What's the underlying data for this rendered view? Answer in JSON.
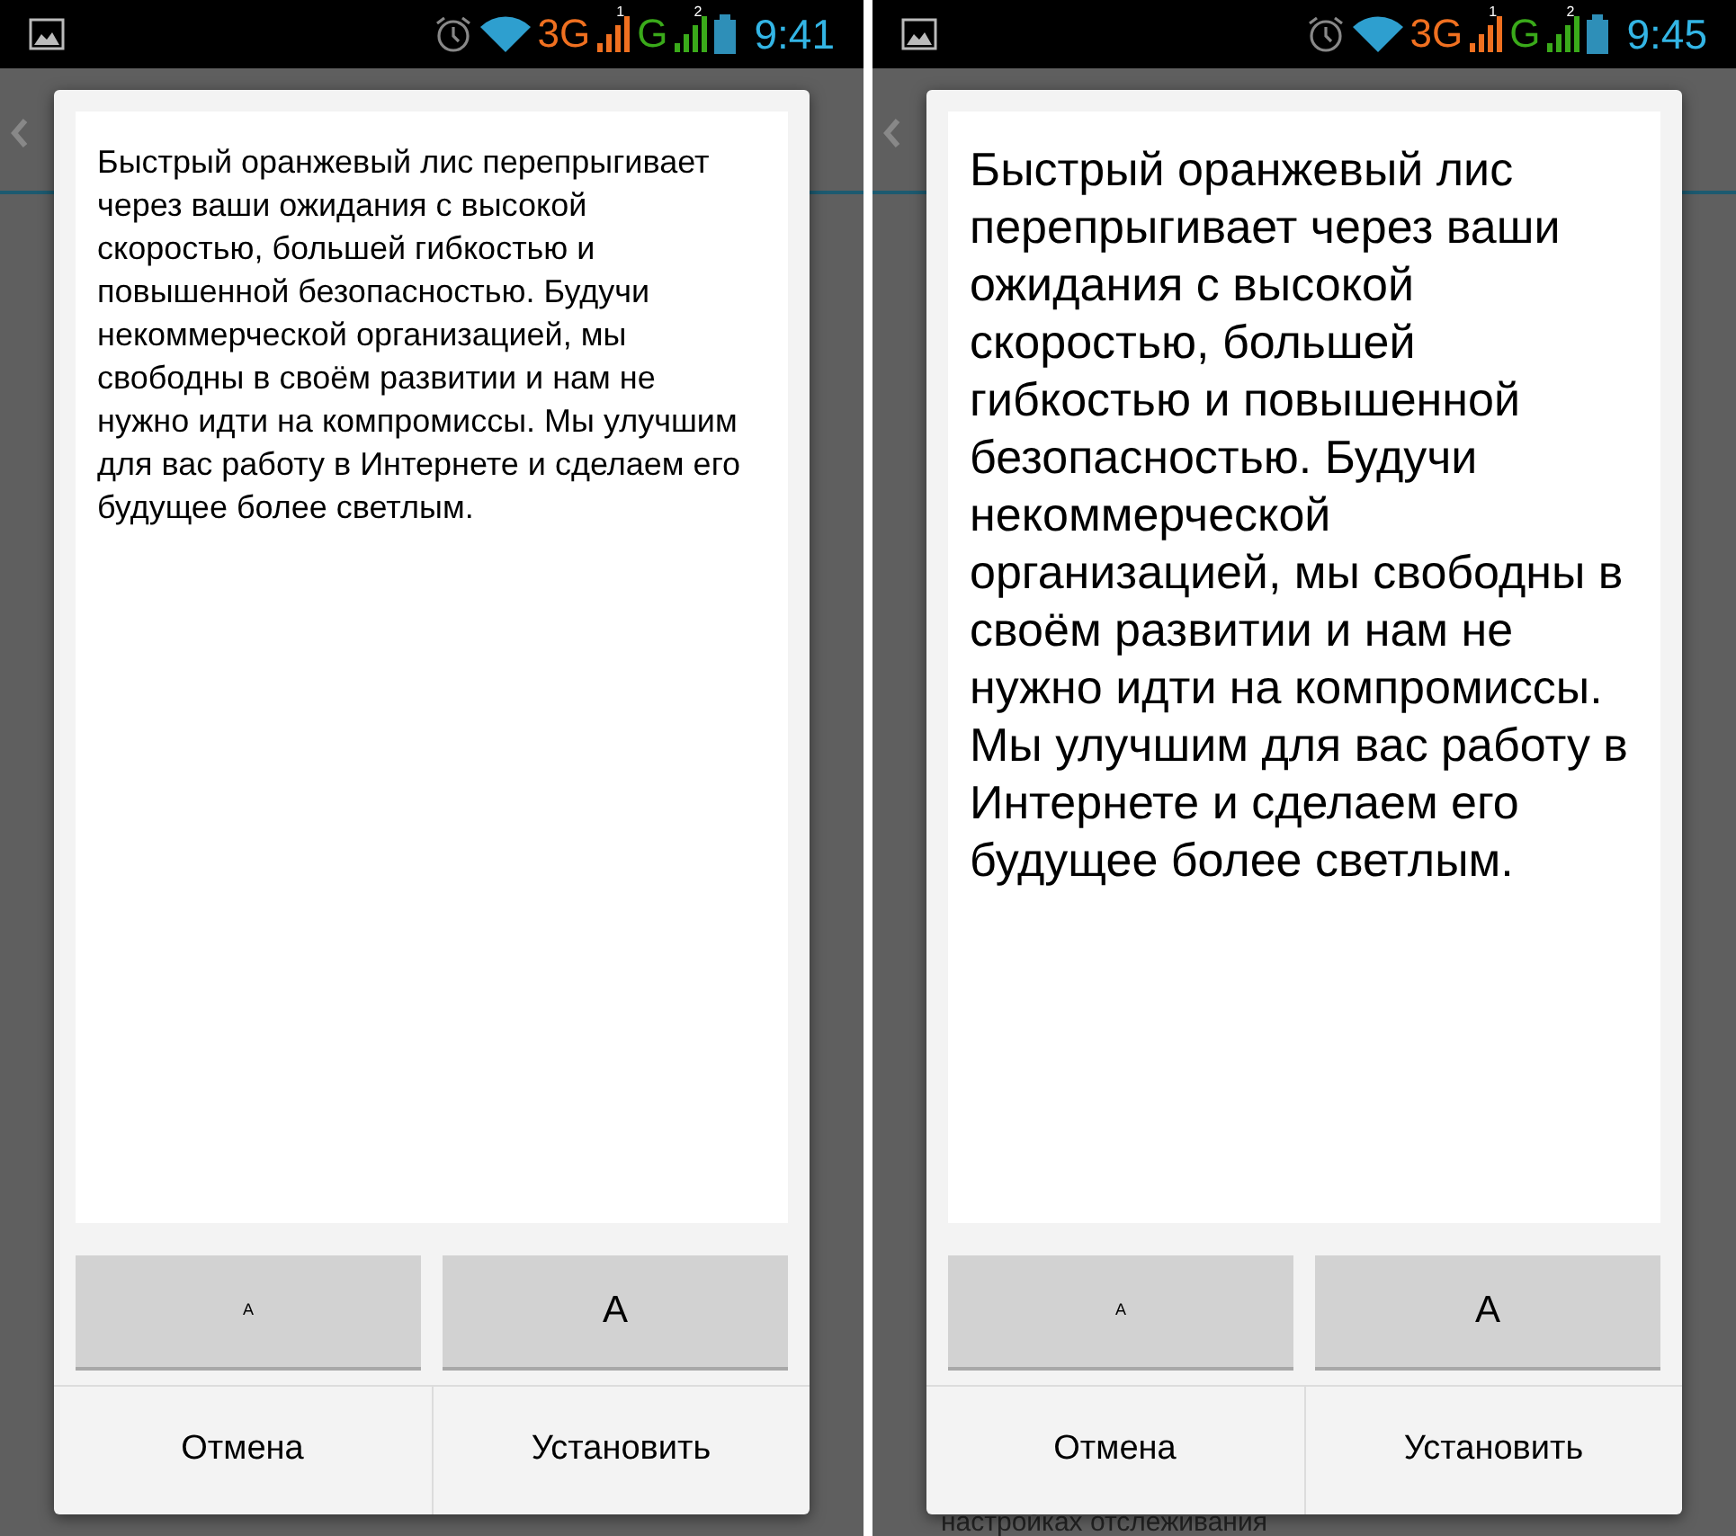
{
  "screens": [
    {
      "status_bar": {
        "network_1": "3G",
        "sim_1": "1",
        "network_2": "G",
        "sim_2": "2",
        "time": "9:41"
      },
      "dialog": {
        "kind": "normal",
        "preview_text": "Быстрый оранжевый лис перепрыгивает через ваши ожидания с высокой скоростью, большей гибкостью и повышенной безопасностью. Будучи некоммерческой организацией, мы свободны в своём развитии и нам не нужно идти на компромиссы. Мы улучшим для вас работу в Интернете и сделаем его будущее более светлым.",
        "smaller_button": "A",
        "larger_button": "A",
        "buttons": [
          "Отмена",
          "Установить"
        ]
      }
    },
    {
      "status_bar": {
        "network_1": "3G",
        "sim_1": "1",
        "network_2": "G",
        "sim_2": "2",
        "time": "9:45"
      },
      "dialog": {
        "kind": "enlarged",
        "preview_text": "Быстрый оранжевый лис перепрыгивает через ваши ожидания с высокой скоростью, большей гибкостью и повышенной безопасностью. Будучи некоммерческой организацией, мы свободны в своём развитии и нам не нужно идти на компромиссы. Мы улучшим для вас работу в Интернете и сделаем его будущее более светлым.",
        "smaller_button": "A",
        "larger_button": "A",
        "buttons": [
          "Отмена",
          "Установить"
        ]
      },
      "background_text": "настройках отслеживания"
    }
  ]
}
